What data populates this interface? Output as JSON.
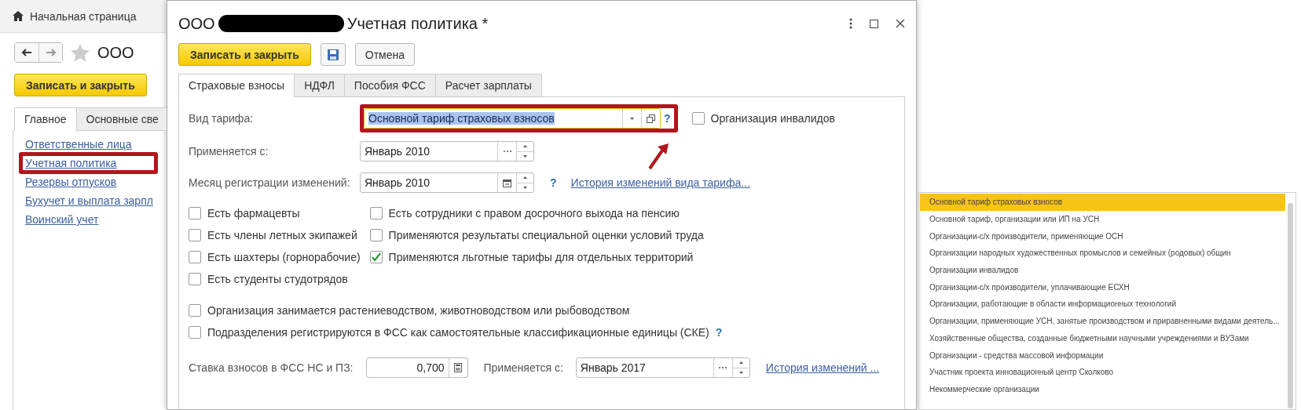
{
  "left_panel": {
    "home_tab": "Начальная страница",
    "title": "ООО",
    "save_button": "Записать и закрыть",
    "tabs": [
      {
        "label": "Главное",
        "selected": true
      },
      {
        "label": "Основные све",
        "selected": false
      }
    ],
    "links": [
      {
        "label": "Ответственные лица",
        "highlighted": false
      },
      {
        "label": "Учетная политика",
        "highlighted": true
      },
      {
        "label": "Резервы отпусков",
        "highlighted": false
      },
      {
        "label": "Бухучет и выплата зарпл",
        "highlighted": false
      },
      {
        "label": "Воинский учет",
        "highlighted": false
      }
    ]
  },
  "dialog": {
    "title_start": "ООО",
    "title_end": "Учетная политика *",
    "save_button": "Записать и закрыть",
    "cancel_button": "Отмена",
    "tabs": [
      {
        "label": "Страховые взносы",
        "selected": true
      },
      {
        "label": "НДФЛ",
        "selected": false
      },
      {
        "label": "Пособия ФСС",
        "selected": false
      },
      {
        "label": "Расчет зарплаты",
        "selected": false
      }
    ],
    "tariff": {
      "label": "Вид тарифа:",
      "value": "Основной тариф страховых взносов",
      "highlighted": true,
      "help": "?"
    },
    "disabled_org": {
      "label": "Организация инвалидов",
      "checked": false
    },
    "applies_from": {
      "label": "Применяется с:",
      "value": "Январь 2010"
    },
    "registration_month": {
      "label": "Месяц регистрации изменений:",
      "value": "Январь 2010",
      "help": "?",
      "link": "История изменений вида тарифа..."
    },
    "checkboxes_left": [
      {
        "label": "Есть фармацевты",
        "checked": false
      },
      {
        "label": "Есть члены летных экипажей",
        "checked": false
      },
      {
        "label": "Есть шахтеры (горнорабочие)",
        "checked": false
      },
      {
        "label": "Есть студенты студотрядов",
        "checked": false
      }
    ],
    "checkboxes_right": [
      {
        "label": "Есть сотрудники с правом досрочного выхода на пенсию",
        "checked": false
      },
      {
        "label": "Применяются результаты специальной оценки условий труда",
        "checked": false
      },
      {
        "label": "Применяются льготные тарифы для отдельных территорий",
        "checked": true
      }
    ],
    "checkboxes_wide": [
      {
        "label": "Организация занимается растениеводством, животноводством или рыбоводством",
        "checked": false
      },
      {
        "label": "Подразделения регистрируются в ФСС как самостоятельные классификационные единицы (СКЕ)",
        "checked": false,
        "help": "?"
      }
    ],
    "rate": {
      "label": "Ставка взносов в ФСС НС и ПЗ:",
      "value": "0,700",
      "applies_label": "Применяется с:",
      "applies_value": "Январь 2017",
      "link": "История изменений ..."
    }
  },
  "dropdown": [
    {
      "label": "Основной тариф страховых взносов",
      "selected": true
    },
    {
      "label": "Основной тариф, организации или ИП на УСН",
      "selected": false
    },
    {
      "label": "Организации-с/х производители, применяющие ОСН",
      "selected": false
    },
    {
      "label": "Организации народных художественных промыслов и семейных (родовых) общин",
      "selected": false
    },
    {
      "label": "Организации инвалидов",
      "selected": false
    },
    {
      "label": "Организации-с/х производители, уплачивающие ЕСХН",
      "selected": false
    },
    {
      "label": "Организации, работающие в области информационных технологий",
      "selected": false
    },
    {
      "label": "Организации, применяющие УСН, занятые производством и приравненными видами деятель...",
      "selected": false
    },
    {
      "label": "Хозяйственные общества, созданные бюджетными научными учреждениями и ВУЗами",
      "selected": false
    },
    {
      "label": "Организации - средства массовой информации",
      "selected": false
    },
    {
      "label": "Участник проекта инновационный центр Сколково",
      "selected": false
    },
    {
      "label": "Некоммерческие организации",
      "selected": false
    }
  ]
}
